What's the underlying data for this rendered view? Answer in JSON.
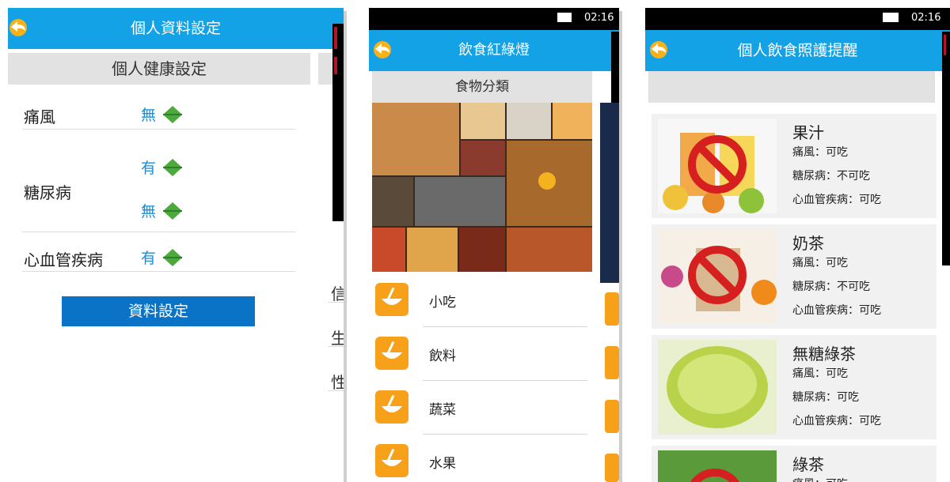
{
  "screen1": {
    "title": "個人資料設定",
    "section": "個人健康設定",
    "rows": [
      {
        "label": "痛風",
        "values": [
          "無"
        ]
      },
      {
        "label": "糖尿病",
        "values": [
          "有",
          "無"
        ]
      },
      {
        "label": "心血管疾病",
        "values": [
          "有"
        ]
      }
    ],
    "button": "資料設定",
    "peek": [
      "信",
      "生",
      "性"
    ]
  },
  "screen2": {
    "time": "02:16",
    "title": "飲食紅綠燈",
    "section": "食物分類",
    "categories": [
      "小吃",
      "飲料",
      "蔬菜",
      "水果"
    ]
  },
  "screen3": {
    "time": "02:16",
    "title": "個人飲食照護提醒",
    "foods": [
      {
        "name": "果汁",
        "gout": "痛風：可吃",
        "diabetes": "糖尿病：不可吃",
        "cardio": "心血管疾病：可吃"
      },
      {
        "name": "奶茶",
        "gout": "痛風：可吃",
        "diabetes": "糖尿病：不可吃",
        "cardio": "心血管疾病：可吃"
      },
      {
        "name": "無糖綠茶",
        "gout": "痛風：可吃",
        "diabetes": "糖尿病：可吃",
        "cardio": "心血管疾病：可吃"
      },
      {
        "name": "綠茶",
        "gout": "痛風：可吃"
      }
    ]
  },
  "colors": {
    "appbar": "#14a2e6",
    "button": "#0a73c6",
    "value": "#1a8fd6",
    "category_icon": "#f7a11a"
  },
  "icons": [
    "back-arrow-icon",
    "up-down-arrow-icon",
    "bowl-icon",
    "battery-icon",
    "no-sign-icon"
  ]
}
